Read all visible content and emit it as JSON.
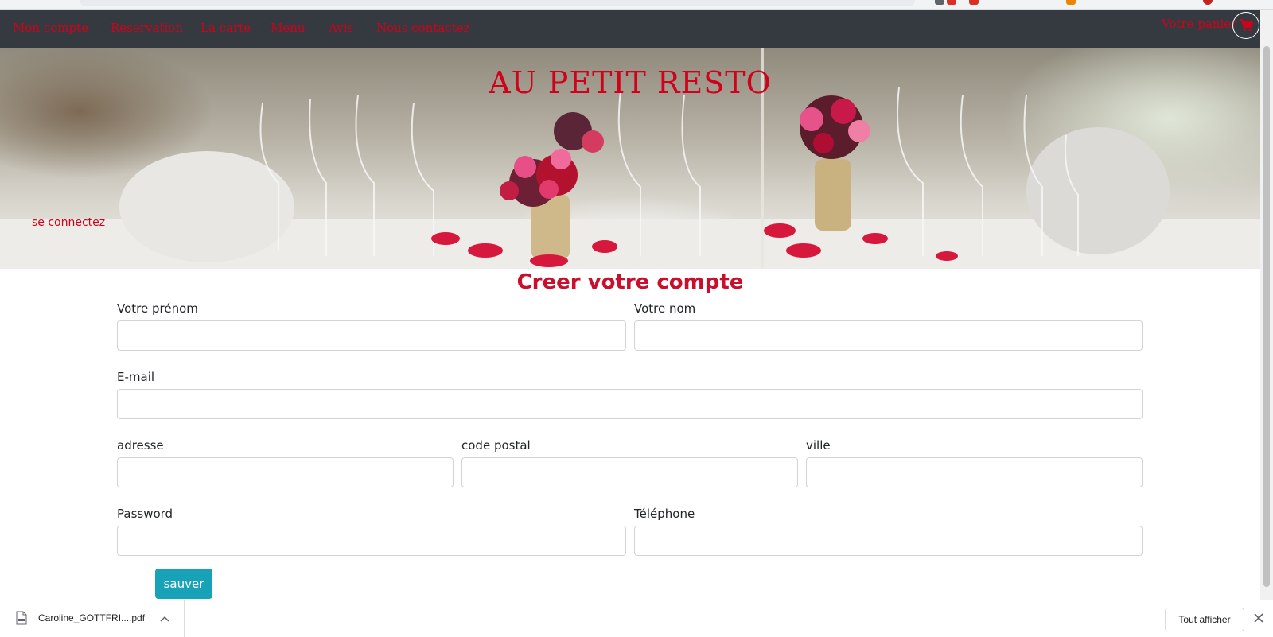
{
  "nav": {
    "items": [
      {
        "label": "Mon compte"
      },
      {
        "label": "Reservation"
      },
      {
        "label": "La carte"
      },
      {
        "label": "Menu"
      },
      {
        "label": "Avis"
      },
      {
        "label": "Nous contactez"
      }
    ],
    "cart_label": "Votre panier",
    "cart_icon": "shopping-cart-icon"
  },
  "hero": {
    "title": "AU PETIT RESTO",
    "login_link": "se connectez"
  },
  "form": {
    "title": "Creer votre compte",
    "fields": {
      "prenom": {
        "label": "Votre prénom",
        "value": ""
      },
      "nom": {
        "label": "Votre nom",
        "value": ""
      },
      "email": {
        "label": "E-mail",
        "value": ""
      },
      "adresse": {
        "label": "adresse",
        "value": ""
      },
      "code_postal": {
        "label": "code postal",
        "value": ""
      },
      "ville": {
        "label": "ville",
        "value": ""
      },
      "password": {
        "label": "Password",
        "value": ""
      },
      "telephone": {
        "label": "Téléphone",
        "value": ""
      }
    },
    "submit_label": "sauver"
  },
  "downloads": {
    "file_name": "Caroline_GOTTFRI....pdf",
    "show_all_label": "Tout afficher"
  },
  "colors": {
    "accent_red": "#d0021b",
    "navbar_bg": "#343a40",
    "button_teal": "#17a2b8"
  }
}
